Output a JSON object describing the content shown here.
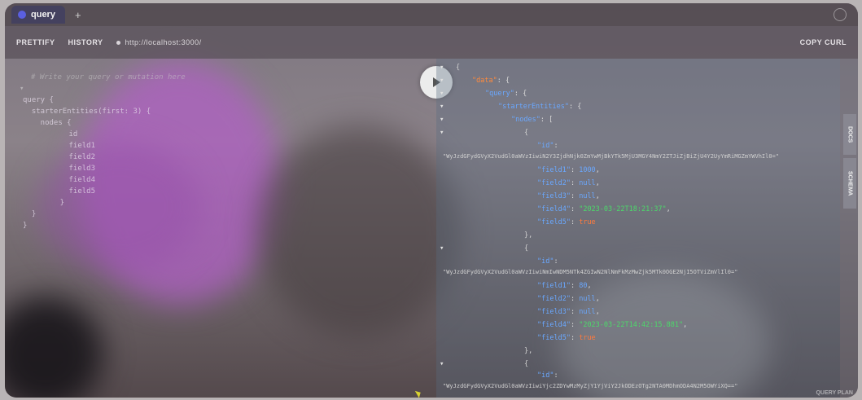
{
  "titlebar": {
    "tab_label": "query",
    "newtab": "+"
  },
  "toolbar": {
    "prettify": "PRETTIFY",
    "history": "HISTORY",
    "url": "http://localhost:3000/",
    "copy_curl": "COPY CURL"
  },
  "editor": {
    "comment": "# Write your query or mutation here",
    "lines": [
      "query {",
      "  starterEntities(first: 3) {",
      "    nodes {",
      "      id",
      "      field1",
      "      field2",
      "      field3",
      "      field4",
      "      field5",
      "    }",
      "  }",
      "}"
    ]
  },
  "results": {
    "open_brace": "{",
    "data_key": "\"data\"",
    "query_key": "\"query\"",
    "starter_key": "\"starterEntities\"",
    "nodes_key": "\"nodes\"",
    "id_key": "\"id\"",
    "node1": {
      "id": "\"WyJzdGFydGVyX2VudGl0aWVzIiwiN2Y3ZjdhNjk0ZmYwMjBkYTk5MjU3MGY4NmY2ZTJiZjBiZjU4Y2UyYmRiMGZmYWVhIl0=\"",
      "field1": "1000",
      "field2": "null",
      "field3": "null",
      "field4": "\"2023-03-22T18:21:37\"",
      "field5": "true"
    },
    "node2": {
      "id": "\"WyJzdGFydGVyX2VudGl0aWVzIiwiNmIwNDM5NTk4ZGIwN2NlNmFkMzMwZjk5MTk0OGE2NjI5OTViZmVlIl0=\"",
      "field1": "80",
      "field2": "null",
      "field3": "null",
      "field4": "\"2023-03-22T14:42:15.881\"",
      "field5": "true"
    },
    "node3": {
      "id": "\"WyJzdGFydGVyX2VudGl0aWVzIiwiYjc2ZDYwMzMyZjY1YjViY2JkODEzOTg2NTA0MDhmODA4N2M5OWYiXQ==\""
    }
  },
  "sidebar": {
    "docs": "DOCS",
    "schema": "SCHEMA"
  },
  "footer": {
    "text": "QUERY PLAN"
  },
  "colors": {
    "key": "#6aa8ff",
    "string": "#4cd96a",
    "bool": "#ff7a3d"
  }
}
